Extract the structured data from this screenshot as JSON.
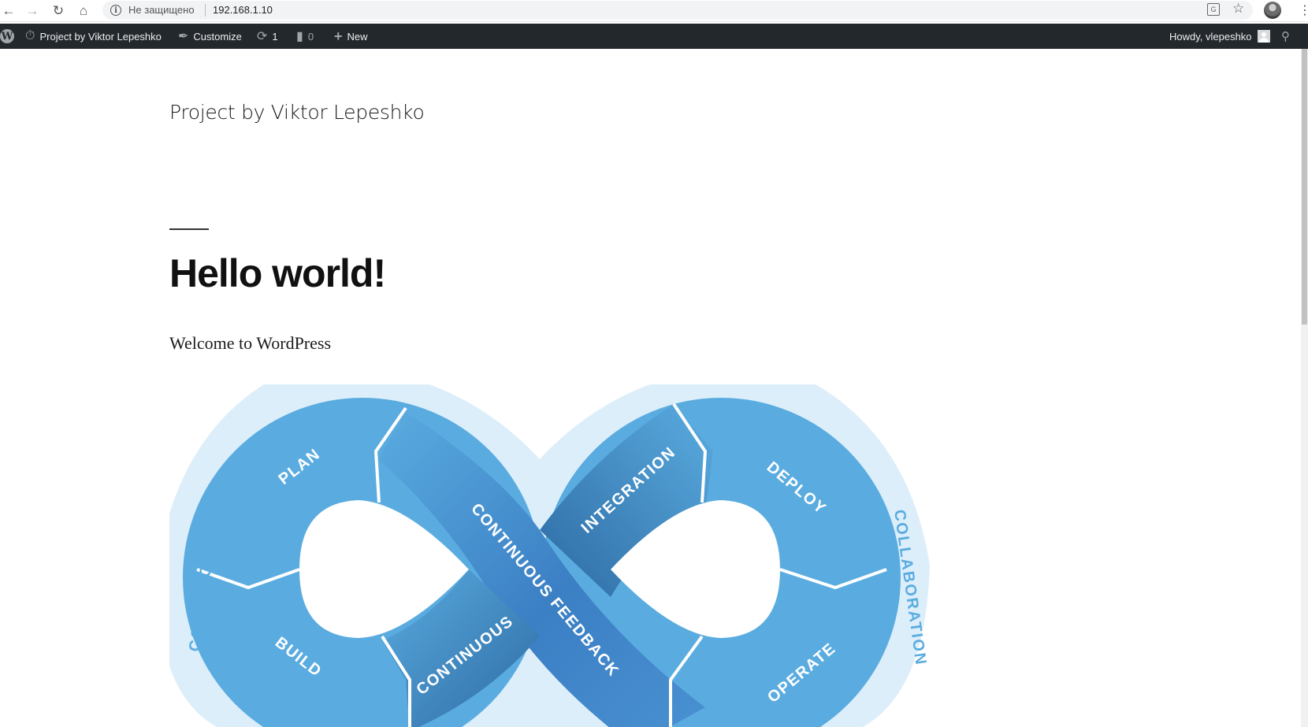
{
  "browser": {
    "security_label": "Не защищено",
    "url": "192.168.1.10"
  },
  "adminbar": {
    "site_name": "Project by Viktor Lepeshko",
    "customize": "Customize",
    "updates_count": "1",
    "comments_count": "0",
    "new_label": "New",
    "howdy": "Howdy, vlepeshko"
  },
  "site": {
    "title": "Project by Viktor Lepeshko"
  },
  "post": {
    "title": "Hello world!",
    "body": "Welcome to WordPress"
  },
  "devops_diagram": {
    "segments": [
      "PLAN",
      "BUILD",
      "CONTINUOUS",
      "CONTINUOUS FEEDBACK",
      "INTEGRATION",
      "DEPLOY",
      "OPERATE"
    ],
    "ring_labels": [
      "COLLABORATION",
      "COLLABORATION"
    ],
    "colors": {
      "light_blue": "#5aace0",
      "mid_blue": "#3f8fd0",
      "dark_blue": "#2e6ea8",
      "ring": "#dceefa"
    }
  }
}
